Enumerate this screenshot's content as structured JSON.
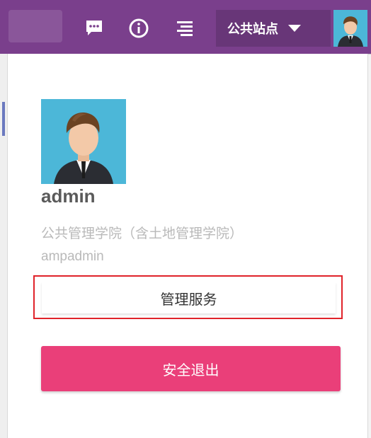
{
  "header": {
    "icons": [
      "message-icon",
      "info-icon",
      "menu-icon"
    ],
    "site_selector": {
      "label": "公共站点"
    }
  },
  "profile": {
    "username": "admin",
    "department": "公共管理学院（含土地管理学院）",
    "account": "ampadmin"
  },
  "actions": {
    "manage_label": "管理服务",
    "logout_label": "安全退出"
  },
  "colors": {
    "header_bg": "#7a3f8c",
    "avatar_bg": "#4cb7d8",
    "logout_bg": "#ea3f79",
    "highlight_border": "#e0232a"
  }
}
